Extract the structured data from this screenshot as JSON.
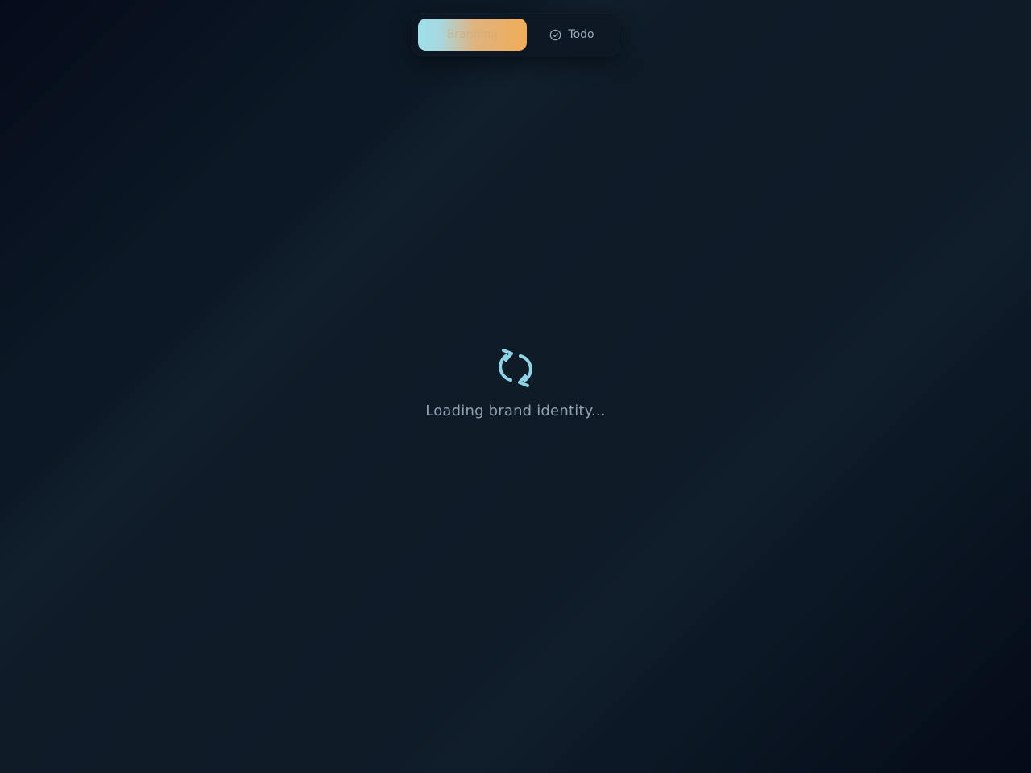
{
  "nav": {
    "tabs": [
      {
        "label": "Branding",
        "icon": "palette-icon",
        "active": true
      },
      {
        "label": "Todo",
        "icon": "check-circle-icon",
        "active": false
      }
    ]
  },
  "loading": {
    "icon": "refresh-icon",
    "message": "Loading brand identity..."
  },
  "colors": {
    "accent_teal": "#8fd3e4",
    "accent_orange": "#f0ad58",
    "background": "#0f1b27"
  }
}
